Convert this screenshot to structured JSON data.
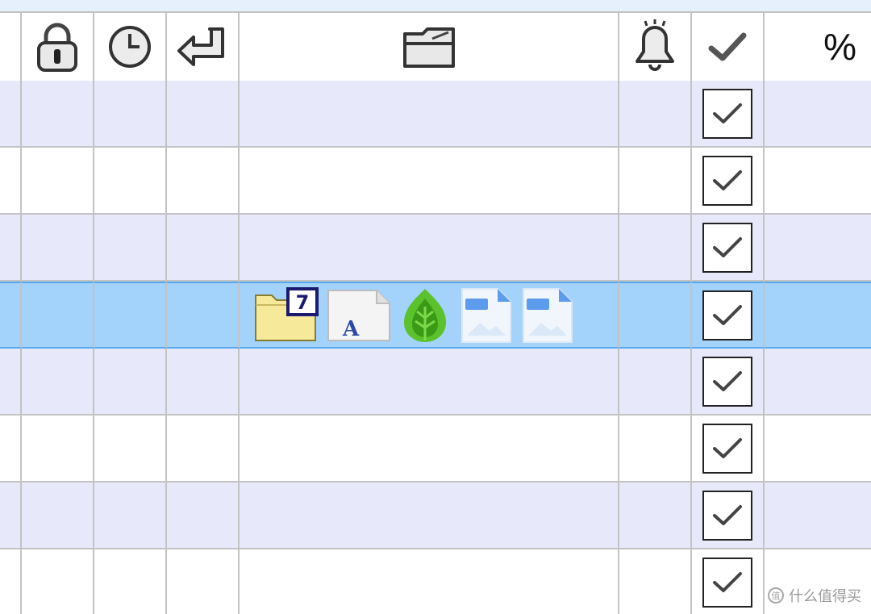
{
  "header": {
    "icons": [
      "lock-icon",
      "clock-icon",
      "return-arrow-icon",
      "folder-icon",
      "bell-icon",
      "checkmark-icon"
    ],
    "percent_label": "%"
  },
  "rows": [
    {
      "checked": true
    },
    {
      "checked": true
    },
    {
      "checked": true
    },
    {
      "checked": true,
      "selected": true,
      "files": [
        "folder-7-icon",
        "font-file-icon",
        "green-leaf-icon",
        "image-file-icon",
        "image-file-icon"
      ]
    },
    {
      "checked": true
    },
    {
      "checked": true
    },
    {
      "checked": true
    },
    {
      "checked": true
    }
  ],
  "watermark": {
    "text": "什么值得买",
    "logo": "值"
  },
  "colors": {
    "odd_row": "#e8e8fb",
    "even_row": "#ffffff",
    "selected_row": "#a3d2fb",
    "selected_border": "#56a9ee",
    "grid_line": "#c3c3c3"
  }
}
